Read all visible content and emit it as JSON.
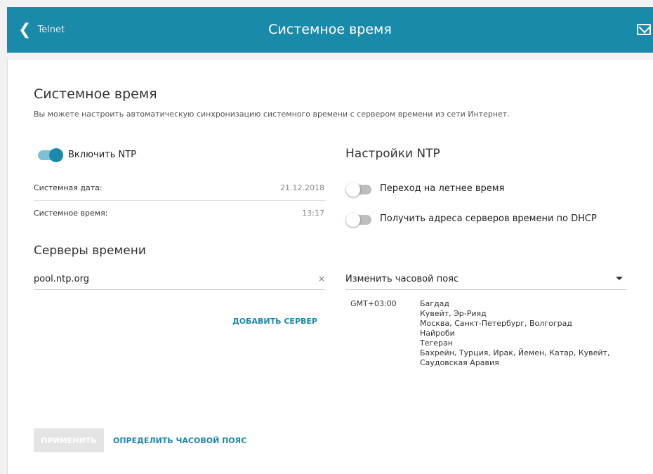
{
  "header": {
    "back_label": "Telnet",
    "title": "Системное время",
    "back_icon": "chevron-left-icon",
    "mail_icon": "mail-icon",
    "color": "#1a8aaa"
  },
  "page": {
    "title": "Системное время",
    "description": "Вы можете настроить автоматическую синхронизацию системного времени с сервером времени из сети Интернет."
  },
  "ntp": {
    "enable_label": "Включить NTP",
    "enabled": true,
    "date_label": "Системная дата:",
    "date_value": "21.12.2018",
    "time_label": "Системное время:",
    "time_value": "13:17"
  },
  "servers": {
    "title": "Серверы времени",
    "value": "pool.ntp.org",
    "clear": "×",
    "add_label": "ДОБАВИТЬ СЕРВЕР"
  },
  "ntp_settings": {
    "title": "Настройки NTP",
    "dst_label": "Переход на летнее время",
    "dst_enabled": false,
    "dhcp_label": "Получить адреса серверов времени по DHCP",
    "dhcp_enabled": false
  },
  "timezone": {
    "select_label": "Изменить часовой пояс",
    "offset": "GMT+03:00",
    "cities": [
      "Багдад",
      "Кувейт, Эр-Рияд",
      "Москва, Санкт-Петербург, Волгоград",
      "Найроби",
      "Тегеран",
      "Бахрейн, Турция, Ирак, Йемен, Катар, Кувейт,",
      "Саудовская Аравия"
    ]
  },
  "actions": {
    "apply_label": "ПРИМЕНИТЬ",
    "detect_label": "ОПРЕДЕЛИТЬ ЧАСОВОЙ ПОЯС"
  }
}
